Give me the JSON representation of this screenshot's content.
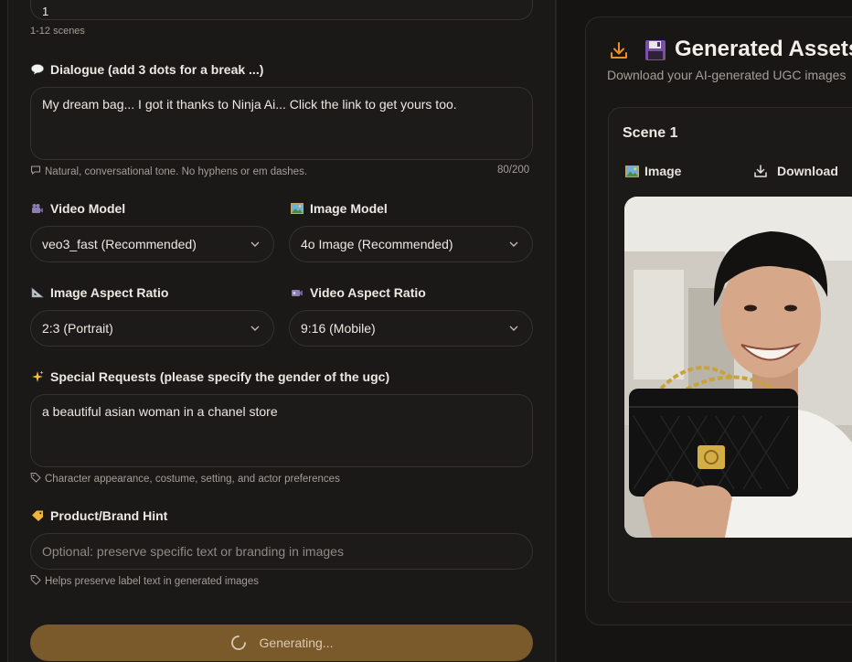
{
  "form": {
    "scene_count_value": "1",
    "scene_count_hint": "1-12 scenes",
    "dialogue": {
      "icon": "speech-balloon",
      "label": "Dialogue (add 3 dots for a break ...)",
      "value": "My dream bag... I got it thanks to Ninja Ai... Click the link to get yours too.",
      "hint": "Natural, conversational tone. No hyphens or em dashes.",
      "counter": "80/200"
    },
    "video_model": {
      "icon": "film-camera",
      "label": "Video Model",
      "value": "veo3_fast (Recommended)"
    },
    "image_model": {
      "icon": "framed-picture",
      "label": "Image Model",
      "value": "4o Image (Recommended)"
    },
    "image_aspect": {
      "icon": "triangular-ruler",
      "label": "Image Aspect Ratio",
      "value": "2:3 (Portrait)"
    },
    "video_aspect": {
      "icon": "video-camera",
      "label": "Video Aspect Ratio",
      "value": "9:16 (Mobile)"
    },
    "special": {
      "icon": "sparkles",
      "label": "Special Requests (please specify the gender of the ugc)",
      "value": "a beautiful asian woman in a chanel store",
      "hint": "Character appearance, costume, setting, and actor preferences"
    },
    "brand": {
      "icon": "label-tag",
      "label": "Product/Brand Hint",
      "placeholder": "Optional: preserve specific text or branding in images",
      "hint": "Helps preserve label text in generated images"
    },
    "generate_label": "Generating..."
  },
  "assets": {
    "title": "Generated Assets",
    "subtitle": "Download your AI-generated UGC images",
    "scene_title": "Scene 1",
    "image_label": "Image",
    "download_label": "Download"
  },
  "colors": {
    "accent": "#e8902a",
    "button": "#7a5a2a",
    "background": "#151413"
  }
}
